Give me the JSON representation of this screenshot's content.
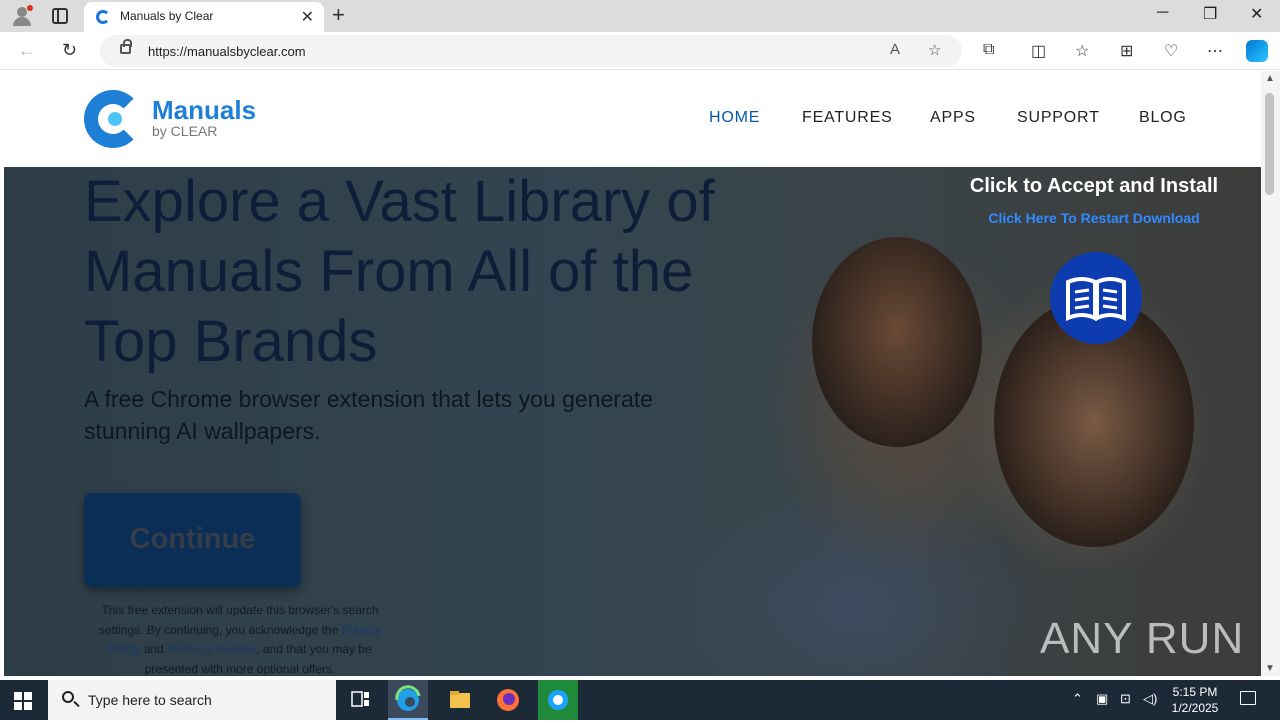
{
  "browser": {
    "tab_title": "Manuals by Clear",
    "url": "https://manualsbyclear.com"
  },
  "site": {
    "logo_name": "Manuals",
    "logo_sub": "by CLEAR",
    "nav": [
      {
        "label": "HOME",
        "active": true
      },
      {
        "label": "FEATURES",
        "active": false
      },
      {
        "label": "APPS",
        "active": false
      },
      {
        "label": "SUPPORT",
        "active": false
      },
      {
        "label": "BLOG",
        "active": false
      }
    ]
  },
  "hero": {
    "title_lines": [
      "Explore a Vast Library of",
      "Manuals From All of the",
      "Top Brands"
    ],
    "description_lines": [
      "A free Chrome browser extension that lets you generate",
      "stunning AI wallpapers."
    ],
    "continue_label": "Continue",
    "disclaimer": {
      "part1": "This free extension will update this browser's search settings. By continuing, you acknowledge the ",
      "privacy_link": "Privacy Policy",
      "part2": " and ",
      "terms_link": "Terms of Service",
      "part3": ", and that you may be presented with more optional offers."
    },
    "cta_title": "Click to Accept and Install",
    "cta_link": "Click Here To Restart Download"
  },
  "watermark": "ANY RUN",
  "taskbar": {
    "search_placeholder": "Type here to search",
    "time": "5:15 PM",
    "date": "1/2/2025"
  },
  "colors": {
    "accent": "#1e7fd6",
    "nav_active": "#0b5aa8",
    "cta_link": "#2f8bff",
    "badge": "#0d3bb0",
    "continue_button": "#0a2e55"
  }
}
